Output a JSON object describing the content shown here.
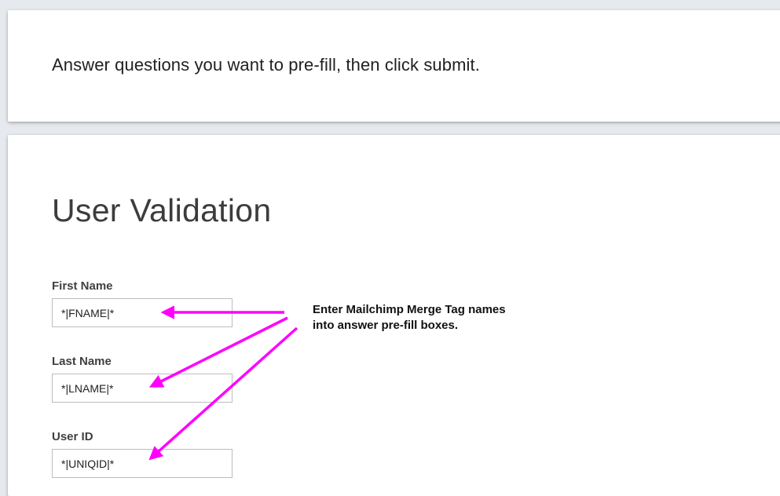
{
  "header": {
    "instructions": "Answer questions you want to pre-fill, then click submit."
  },
  "form": {
    "title": "User Validation",
    "fields": [
      {
        "label": "First Name",
        "value": "*|FNAME|*"
      },
      {
        "label": "Last Name",
        "value": "*|LNAME|*"
      },
      {
        "label": "User ID",
        "value": "*|UNIQID|*"
      }
    ]
  },
  "annotation": {
    "line1": "Enter Mailchimp Merge Tag names",
    "line2": "into answer pre-fill boxes.",
    "arrow_color": "#ff00ff"
  }
}
